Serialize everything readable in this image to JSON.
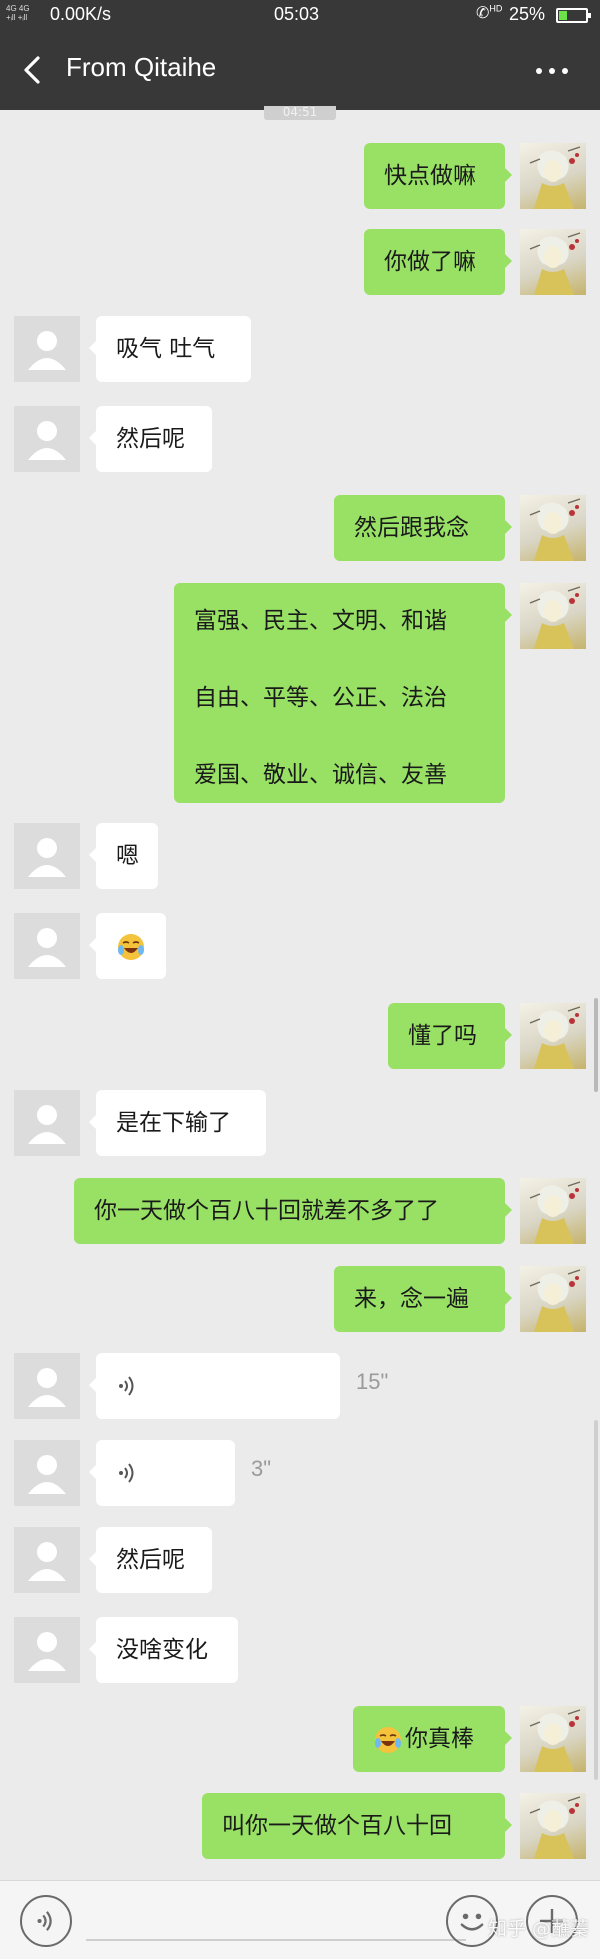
{
  "status_bar": {
    "signal": "4G 4G",
    "speed": "0.00K/s",
    "time": "05:03",
    "calls": "HD",
    "battery": "25%"
  },
  "nav": {
    "title": "From Qitaihe",
    "timestamp_partial": "04:51"
  },
  "messages": [
    {
      "side": "right",
      "text": "快点做嘛"
    },
    {
      "side": "right",
      "text": "你做了嘛"
    },
    {
      "side": "left",
      "text": "吸气  吐气"
    },
    {
      "side": "left",
      "text": "然后呢"
    },
    {
      "side": "right",
      "text": "然后跟我念"
    },
    {
      "side": "right",
      "lines": [
        "富强、民主、文明、和谐",
        "自由、平等、公正、法治",
        "爱国、敬业、诚信、友善"
      ]
    },
    {
      "side": "left",
      "text": "嗯"
    },
    {
      "side": "left",
      "emoji": "laugh-cry-emoji"
    },
    {
      "side": "right",
      "text": "懂了吗"
    },
    {
      "side": "left",
      "text": "是在下输了"
    },
    {
      "side": "right",
      "text": "你一天做个百八十回就差不多了了"
    },
    {
      "side": "right",
      "text": "来，念一遍"
    },
    {
      "side": "left",
      "voice": true,
      "duration": "15\""
    },
    {
      "side": "left",
      "voice": true,
      "duration": "3\""
    },
    {
      "side": "left",
      "text": "然后呢"
    },
    {
      "side": "left",
      "text": "没啥变化"
    },
    {
      "side": "right",
      "text": "你真棒",
      "emoji": "laugh-cry-emoji"
    },
    {
      "side": "right",
      "text": "叫你一天做个百八十回"
    }
  ],
  "watermark": "知乎 @蘸蓁",
  "colors": {
    "header": "#383838",
    "background": "#ebebeb",
    "sent_bubble": "#98e165",
    "received_bubble": "#ffffff"
  }
}
